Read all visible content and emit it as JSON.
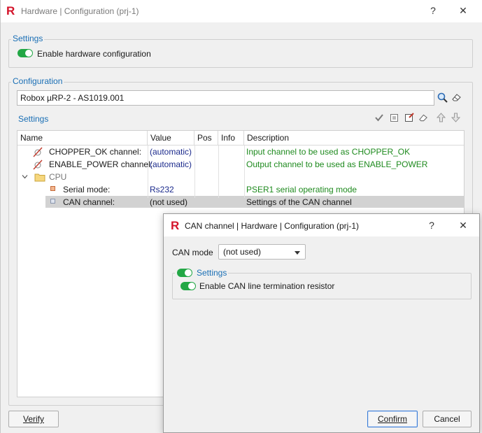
{
  "main_window": {
    "app_logo": "R",
    "title": "Hardware | Configuration (prj-1)",
    "help_glyph": "?",
    "close_glyph": "✕"
  },
  "settings_group": {
    "title": "Settings",
    "enable_hw_label": "Enable hardware configuration",
    "enable_hw_on": true
  },
  "configuration_group": {
    "title": "Configuration",
    "device_value": "Robox µRP-2 - AS1019.001",
    "icons": [
      "search-icon",
      "eraser-icon"
    ]
  },
  "settings_tree": {
    "title": "Settings",
    "toolbar_icons": [
      "check-icon",
      "image-edit-icon",
      "note-edit-icon",
      "eraser-icon",
      "arrow-up-icon",
      "arrow-down-icon"
    ],
    "columns": [
      "Name",
      "Value",
      "Pos",
      "Info",
      "Description"
    ],
    "rows": [
      {
        "name": "CHOPPER_OK channel:",
        "value": "(automatic)",
        "pos": "",
        "info": "",
        "description": "Input channel to be used as CHOPPER_OK",
        "icon": "disabled-channel-icon"
      },
      {
        "name": "ENABLE_POWER channel:",
        "value": "(automatic)",
        "pos": "",
        "info": "",
        "description": "Output channel to be used as ENABLE_POWER",
        "icon": "disabled-channel-icon"
      },
      {
        "name": "CPU",
        "value": "",
        "pos": "",
        "info": "",
        "description": "",
        "icon": "folder-icon"
      },
      {
        "name": "Serial mode:",
        "value": "Rs232",
        "pos": "",
        "info": "",
        "description": "PSER1 serial operating mode",
        "icon": "bullet-orange-icon"
      },
      {
        "name": "CAN channel:",
        "value": "(not used)",
        "pos": "",
        "info": "",
        "description": "Settings of the CAN channel",
        "icon": "bullet-gray-icon"
      }
    ]
  },
  "footer": {
    "verify_label": "Verify"
  },
  "can_dialog": {
    "app_logo": "R",
    "title": "CAN channel | Hardware | Configuration (prj-1)",
    "help_glyph": "?",
    "close_glyph": "✕",
    "can_mode_label": "CAN mode",
    "can_mode_value": "(not used)",
    "settings_title": "Settings",
    "settings_on": true,
    "termination_label": "Enable CAN line termination resistor",
    "termination_on": true,
    "confirm_label": "Confirm",
    "cancel_label": "Cancel"
  },
  "colors": {
    "accent_blue": "#1a6fb5",
    "toggle_green": "#22a745",
    "logo_red": "#d4142a",
    "value_blue": "#1b2a8c",
    "desc_green": "#1e8a1e"
  }
}
